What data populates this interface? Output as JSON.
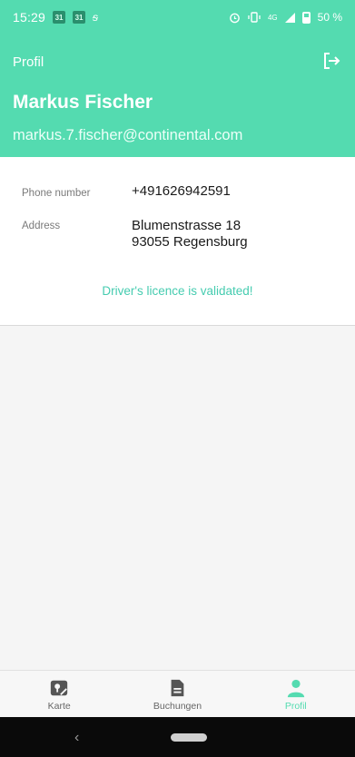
{
  "status_bar": {
    "time": "15:29",
    "cal1": "31",
    "cal2": "31",
    "signal_a": "ƫ",
    "network": "4G",
    "battery": "50 %"
  },
  "header": {
    "title": "Profil",
    "user_name": "Markus Fischer",
    "email": "markus.7.fischer@continental.com"
  },
  "profile": {
    "phone_label": "Phone number",
    "phone_value": "+491626942591",
    "address_label": "Address",
    "address_line1": "Blumenstrasse 18",
    "address_line2": "93055 Regensburg",
    "licence_status": "Driver's licence is validated!"
  },
  "bottom_nav": {
    "items": [
      {
        "label": "Karte",
        "icon": "map-icon"
      },
      {
        "label": "Buchungen",
        "icon": "document-icon"
      },
      {
        "label": "Profil",
        "icon": "person-icon"
      }
    ],
    "active": "Profil"
  },
  "colors": {
    "accent": "#54dbb0",
    "validated_text": "#46ccb0"
  },
  "system_nav": {
    "back_glyph": "‹"
  }
}
